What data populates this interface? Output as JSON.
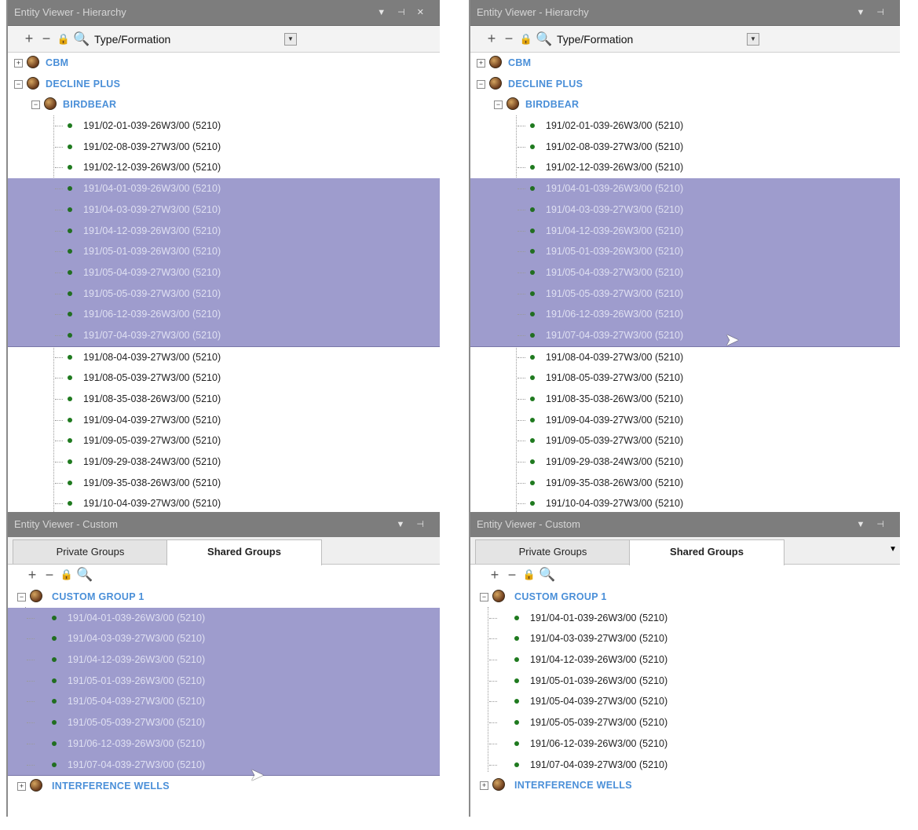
{
  "left": {
    "hierarchy_title": "Entity Viewer - Hierarchy",
    "combo_value": "Type/Formation",
    "groups": {
      "cbm": "CBM",
      "decline_plus": "DECLINE PLUS",
      "birdbear": "BIRDBEAR"
    },
    "wells": [
      "191/02-01-039-26W3/00 (5210)",
      "191/02-08-039-27W3/00 (5210)",
      "191/02-12-039-26W3/00 (5210)",
      "191/04-01-039-26W3/00 (5210)",
      "191/04-03-039-27W3/00 (5210)",
      "191/04-12-039-26W3/00 (5210)",
      "191/05-01-039-26W3/00 (5210)",
      "191/05-04-039-27W3/00 (5210)",
      "191/05-05-039-27W3/00 (5210)",
      "191/06-12-039-26W3/00 (5210)",
      "191/07-04-039-27W3/00 (5210)",
      "191/08-04-039-27W3/00 (5210)",
      "191/08-05-039-27W3/00 (5210)",
      "191/08-35-038-26W3/00 (5210)",
      "191/09-04-039-27W3/00 (5210)",
      "191/09-05-039-27W3/00 (5210)",
      "191/09-29-038-24W3/00 (5210)",
      "191/09-35-038-26W3/00 (5210)",
      "191/10-04-039-27W3/00 (5210)"
    ],
    "custom_title": "Entity Viewer - Custom",
    "tabs": [
      "Private Groups",
      "Shared Groups"
    ],
    "custom_group": "CUSTOM GROUP 1",
    "custom_wells": [
      "191/04-01-039-26W3/00 (5210)",
      "191/04-03-039-27W3/00 (5210)",
      "191/04-12-039-26W3/00 (5210)",
      "191/05-01-039-26W3/00 (5210)",
      "191/05-04-039-27W3/00 (5210)",
      "191/05-05-039-27W3/00 (5210)",
      "191/06-12-039-26W3/00 (5210)",
      "191/07-04-039-27W3/00 (5210)"
    ],
    "interference": "INTERFERENCE WELLS"
  },
  "right": {
    "hierarchy_title": "Entity Viewer - Hierarchy",
    "combo_value": "Type/Formation",
    "groups": {
      "cbm": "CBM",
      "decline_plus": "DECLINE PLUS",
      "birdbear": "BIRDBEAR"
    },
    "wells": [
      "191/02-01-039-26W3/00 (5210)",
      "191/02-08-039-27W3/00 (5210)",
      "191/02-12-039-26W3/00 (5210)",
      "191/04-01-039-26W3/00 (5210)",
      "191/04-03-039-27W3/00 (5210)",
      "191/04-12-039-26W3/00 (5210)",
      "191/05-01-039-26W3/00 (5210)",
      "191/05-04-039-27W3/00 (5210)",
      "191/05-05-039-27W3/00 (5210)",
      "191/06-12-039-26W3/00 (5210)",
      "191/07-04-039-27W3/00 (5210)",
      "191/08-04-039-27W3/00 (5210)",
      "191/08-05-039-27W3/00 (5210)",
      "191/08-35-038-26W3/00 (5210)",
      "191/09-04-039-27W3/00 (5210)",
      "191/09-05-039-27W3/00 (5210)",
      "191/09-29-038-24W3/00 (5210)",
      "191/09-35-038-26W3/00 (5210)",
      "191/10-04-039-27W3/00 (5210)"
    ],
    "custom_title": "Entity Viewer - Custom",
    "tabs": [
      "Private Groups",
      "Shared Groups"
    ],
    "custom_group": "CUSTOM GROUP 1",
    "custom_wells": [
      "191/04-01-039-26W3/00 (5210)",
      "191/04-03-039-27W3/00 (5210)",
      "191/04-12-039-26W3/00 (5210)",
      "191/05-01-039-26W3/00 (5210)",
      "191/05-04-039-27W3/00 (5210)",
      "191/05-05-039-27W3/00 (5210)",
      "191/06-12-039-26W3/00 (5210)",
      "191/07-04-039-27W3/00 (5210)"
    ],
    "interference": "INTERFERENCE WELLS"
  },
  "selection": {
    "left_hierarchy": [
      3,
      4,
      5,
      6,
      7,
      8,
      9,
      10
    ],
    "right_hierarchy": [
      3,
      4,
      5,
      6,
      7,
      8,
      9,
      10
    ],
    "left_custom": [
      0,
      1,
      2,
      3,
      4,
      5,
      6,
      7
    ],
    "right_custom": []
  }
}
